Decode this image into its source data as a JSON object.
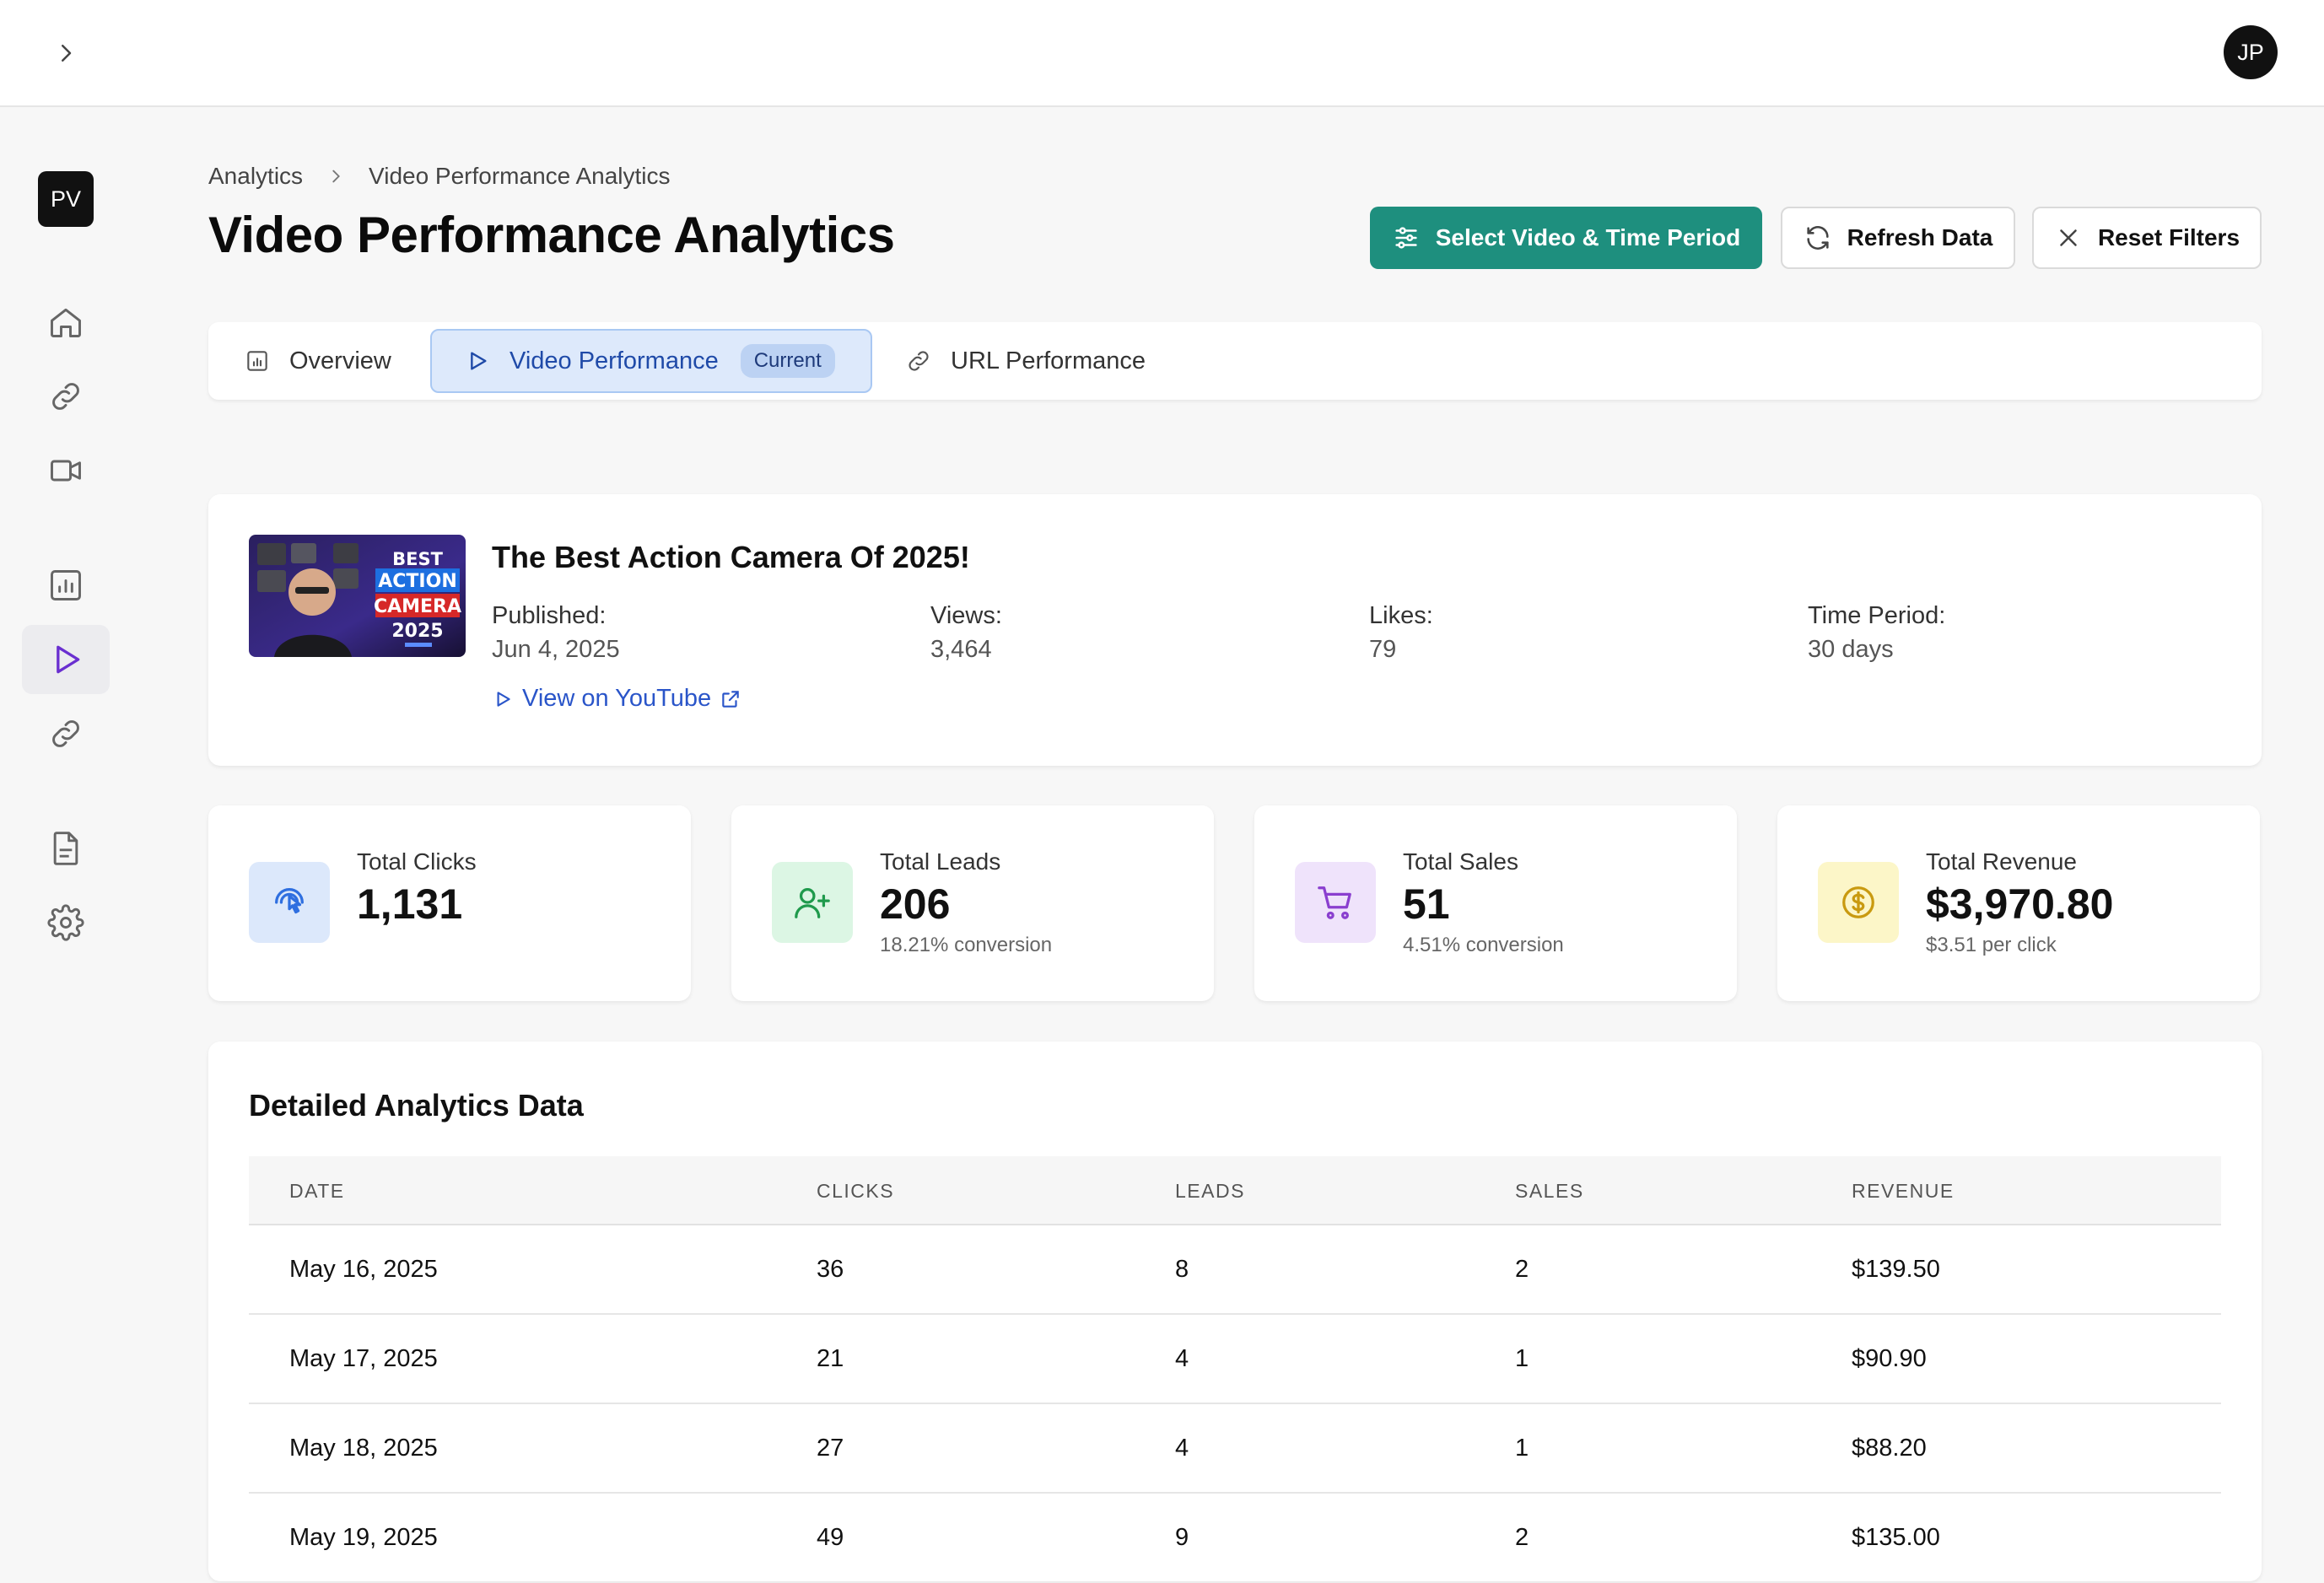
{
  "topbar": {
    "user_initials": "JP"
  },
  "sidebar": {
    "logo": "PV"
  },
  "breadcrumb": {
    "parent": "Analytics",
    "current": "Video Performance Analytics"
  },
  "page": {
    "title": "Video Performance Analytics"
  },
  "actions": {
    "select_label": "Select Video & Time Period",
    "refresh_label": "Refresh Data",
    "reset_label": "Reset Filters"
  },
  "tabs": {
    "overview": "Overview",
    "video": "Video Performance",
    "video_badge": "Current",
    "url": "URL Performance"
  },
  "video": {
    "title": "The Best Action Camera Of 2025!",
    "thumbnail_text": [
      "BEST",
      "ACTION",
      "CAMERA",
      "2025"
    ],
    "published_label": "Published:",
    "published": "Jun 4, 2025",
    "views_label": "Views:",
    "views": "3,464",
    "likes_label": "Likes:",
    "likes": "79",
    "period_label": "Time Period:",
    "period": "30 days",
    "link_label": "View on YouTube"
  },
  "stats": [
    {
      "label": "Total Clicks",
      "value": "1,131",
      "sub": "",
      "icon": "pointer-click-icon",
      "color": "#2f6fe0",
      "bg": "#dce8fb"
    },
    {
      "label": "Total Leads",
      "value": "206",
      "sub": "18.21% conversion",
      "icon": "user-plus-icon",
      "color": "#1f9a4c",
      "bg": "#dcf6e4"
    },
    {
      "label": "Total Sales",
      "value": "51",
      "sub": "4.51% conversion",
      "icon": "shopping-cart-icon",
      "color": "#8a3fcf",
      "bg": "#efe3fb"
    },
    {
      "label": "Total Revenue",
      "value": "$3,970.80",
      "sub": "$3.51 per click",
      "icon": "dollar-circle-icon",
      "color": "#c99a10",
      "bg": "#fcf6c8"
    }
  ],
  "table": {
    "title": "Detailed Analytics Data",
    "headers": [
      "DATE",
      "CLICKS",
      "LEADS",
      "SALES",
      "REVENUE"
    ],
    "rows": [
      [
        "May 16, 2025",
        "36",
        "8",
        "2",
        "$139.50"
      ],
      [
        "May 17, 2025",
        "21",
        "4",
        "1",
        "$90.90"
      ],
      [
        "May 18, 2025",
        "27",
        "4",
        "1",
        "$88.20"
      ],
      [
        "May 19, 2025",
        "49",
        "9",
        "2",
        "$135.00"
      ]
    ]
  },
  "colors": {
    "accent": "#1e8f7e",
    "active_tab": "#dde9fb",
    "link": "#2a55c9",
    "sidebar_active_icon": "#6a2fd0"
  }
}
